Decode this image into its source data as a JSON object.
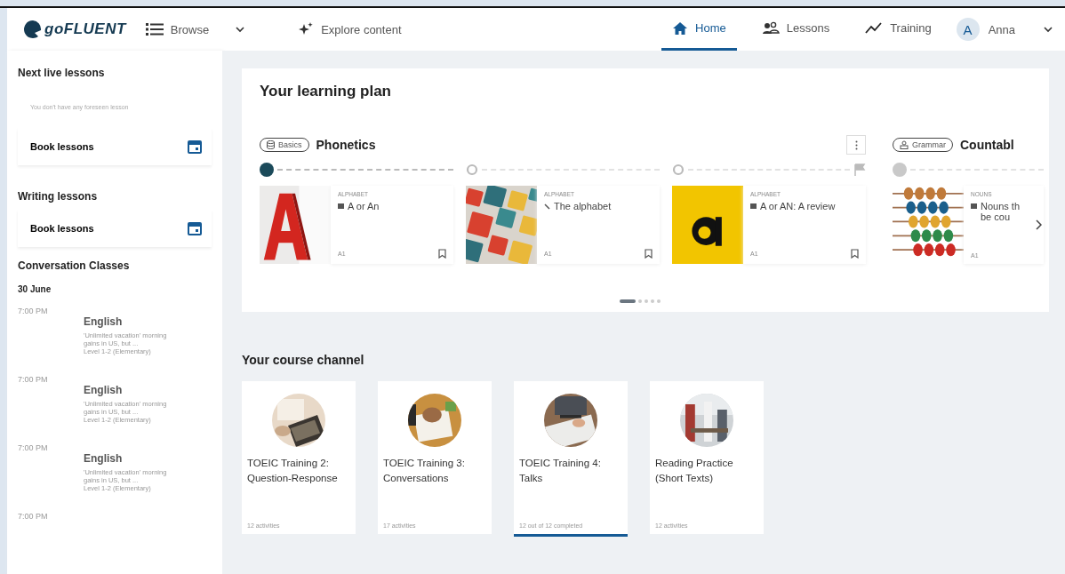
{
  "header": {
    "logo": "goFLUENT",
    "browse": "Browse",
    "explore": "Explore content",
    "nav": [
      {
        "label": "Home",
        "kind": "home",
        "selected": true
      },
      {
        "label": "Lessons",
        "kind": "lessons",
        "selected": false
      },
      {
        "label": "Training",
        "kind": "training",
        "selected": false
      }
    ],
    "user": {
      "initial": "A",
      "name": "Anna"
    }
  },
  "sidebar": {
    "live": {
      "title": "Next live lessons",
      "empty": "You don't have any foreseen lesson",
      "book": "Book lessons"
    },
    "writing": {
      "title": "Writing lessons",
      "book": "Book lessons"
    },
    "conversation": {
      "title": "Conversation Classes",
      "date": "30 June",
      "classes": [
        {
          "time": "7:00 PM",
          "language": "English",
          "description": "'Unlimited vacation' morning gains in US, but ...",
          "level": "Level 1-2 (Elementary)"
        },
        {
          "time": "7:00 PM",
          "language": "English",
          "description": "'Unlimited vacation' morning gains in US, but ...",
          "level": "Level 1-2 (Elementary)"
        },
        {
          "time": "7:00 PM",
          "language": "English",
          "description": "'Unlimited vacation' morning gains in US, but ...",
          "level": "Level 1-2 (Elementary)"
        },
        {
          "time": "7:00 PM"
        }
      ]
    }
  },
  "plan": {
    "title": "Your learning plan",
    "sections": [
      {
        "tag": "Basics",
        "title": "Phonetics",
        "finish_flag": true,
        "lessons": [
          {
            "category": "ALPHABET",
            "title": "A or An",
            "kind": "page",
            "level": "A1",
            "bookmark": true,
            "current": true,
            "locked": false
          },
          {
            "category": "ALPHABET",
            "title": "The alphabet",
            "kind": "pen",
            "level": "A1",
            "bookmark": true,
            "current": false,
            "locked": false
          },
          {
            "category": "ALPHABET",
            "title": "A or AN: A review",
            "kind": "page",
            "level": "A1",
            "bookmark": true,
            "current": false,
            "locked": false
          }
        ]
      },
      {
        "tag": "Grammar",
        "title": "Countabl",
        "lessons": [
          {
            "category": "NOUNS",
            "title": "Nouns th be cou",
            "kind": "page",
            "level": "A1",
            "bookmark": false,
            "current": false,
            "locked": true
          }
        ]
      }
    ],
    "pages": [
      {
        "selected": true
      },
      {
        "selected": false
      },
      {
        "selected": false
      },
      {
        "selected": false
      },
      {
        "selected": false
      }
    ]
  },
  "channel": {
    "title": "Your course channel",
    "courses": [
      {
        "title": "TOEIC Training 2: Question-Response",
        "meta": "12 activities",
        "completed": false
      },
      {
        "title": "TOEIC Training 3: Conversations",
        "meta": "17 activities",
        "completed": false
      },
      {
        "title": "TOEIC Training 4: Talks",
        "meta": "12 out of 12 completed",
        "completed": true
      },
      {
        "title": "Reading Practice (Short Texts)",
        "meta": "12 activities",
        "completed": false
      }
    ]
  }
}
